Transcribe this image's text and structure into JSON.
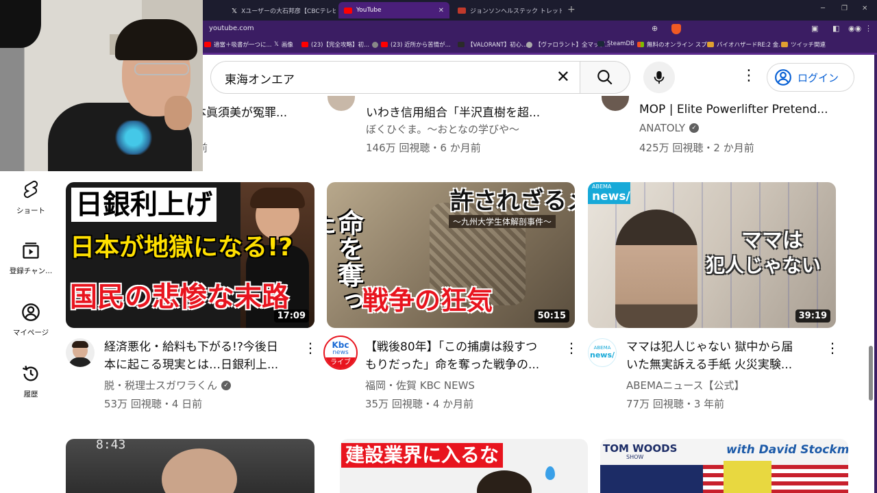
{
  "tabs": [
    {
      "label": "Xユーザーの大石邦彦【CBCテレビ解説】",
      "active": false
    },
    {
      "label": "YouTube",
      "active": true
    },
    {
      "label": "ジョンソンヘルステック トレッドミル 業務用",
      "active": false
    }
  ],
  "address": {
    "url": "youtube.com"
  },
  "bookmarks": [
    "適當＋吸書が一つに...",
    "画像",
    "(23)【完全攻略】初...",
    "(23) 近所から苦情が...",
    "【VALORANT】初心...",
    "【ヴァロラント】全マップ...",
    "SteamDB",
    "無料のオンライン スプ...",
    "バイオハザードRE:2 金...",
    "ツイッチ関連"
  ],
  "search": {
    "query": "東海オンエア"
  },
  "header": {
    "login_label": "ログイン"
  },
  "sidebar": {
    "items": [
      {
        "label": "ショート",
        "icon": "shorts-icon"
      },
      {
        "label": "登録チャン...",
        "icon": "subscriptions-icon"
      },
      {
        "label": "マイページ",
        "icon": "user-icon"
      },
      {
        "label": "履歴",
        "icon": "history-icon"
      }
    ]
  },
  "top_row": [
    {
      "title_tail": "本眞須美が冤罪...",
      "meta_tail": "前"
    },
    {
      "title": "いわき信用組合「半沢直樹を超...",
      "channel": "ぼくひぐま。〜おとなの学びや〜",
      "meta": "146万 回視聴・6 か月前"
    },
    {
      "title": "MOP | Elite Powerlifter Pretend...",
      "channel": "ANATOLY",
      "verified": true,
      "meta": "425万 回視聴・2 か月前"
    }
  ],
  "videos": [
    {
      "thumb_text": [
        "日銀利上げ",
        "日本が地獄になる!?",
        "国民の悲惨な末路"
      ],
      "duration": "17:09",
      "title_lines": [
        "経済悪化・給料も下がる!?今後日",
        "本に起こる現実とは…日銀利上..."
      ],
      "channel": "脱・税理士スガワラくん",
      "verified": true,
      "meta": "53万 回視聴・4 日前"
    },
    {
      "thumb_text": [
        "許されざるメス",
        "〜九州大学生体解剖事件〜",
        "命を奪った",
        "戦争の狂気"
      ],
      "duration": "50:15",
      "title_lines": [
        "【戦後80年】「この捕虜は殺すつ",
        "もりだった」命を奪った戦争の..."
      ],
      "channel": "福岡・佐賀 KBC NEWS",
      "avatar_text": [
        "Kbc",
        "news",
        "ライブ"
      ],
      "verified": false,
      "meta": "35万 回視聴・4 か月前"
    },
    {
      "thumb_text": [
        "ABEMA",
        "news/",
        "ママは",
        "犯人じゃない"
      ],
      "duration": "39:19",
      "title_lines": [
        "ママは犯人じゃない 獄中から届",
        "いた無実訴える手紙 火災実験..."
      ],
      "channel": "ABEMAニュース【公式】",
      "avatar_text": [
        "ABEMA",
        "news/"
      ],
      "verified": false,
      "meta": "77万 回視聴・3 年前"
    }
  ],
  "bottom_row": [
    {
      "thumb_text": "8:43"
    },
    {
      "thumb_text": "建設業界に入るな"
    },
    {
      "thumb_text": [
        "TOM WOODS",
        "SHOW",
        "with David Stockman"
      ]
    }
  ],
  "colors": {
    "accent": "#065fd4",
    "browser_purple": "#3b1d63",
    "tab_active": "#4a1f7a"
  }
}
